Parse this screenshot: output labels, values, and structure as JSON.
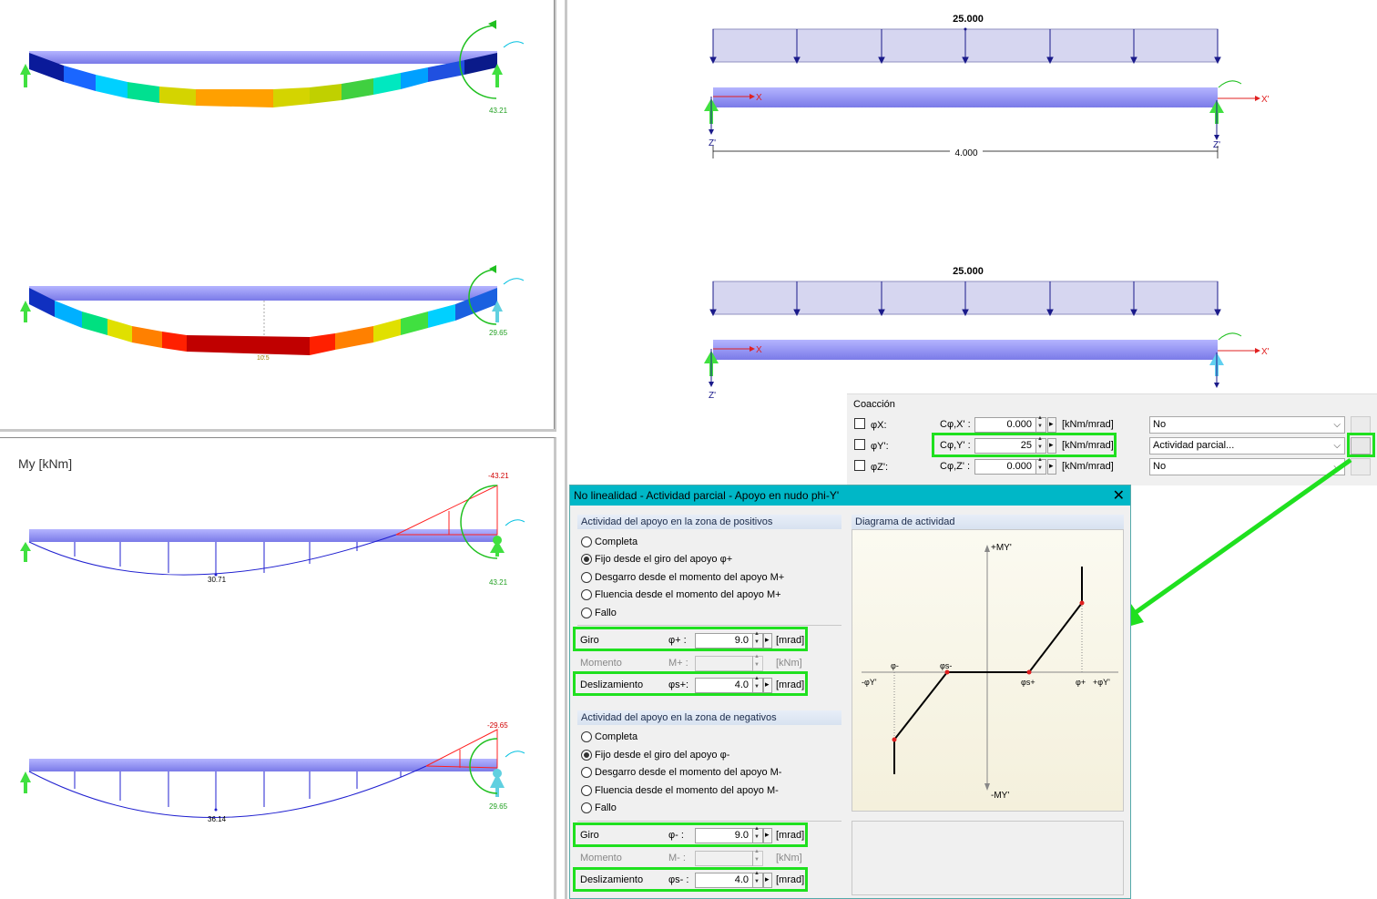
{
  "top_left": {
    "beam1": {
      "value_right": "43.21"
    },
    "beam2": {
      "value_right": "29.65",
      "value_mid": "10.5"
    }
  },
  "moment_panel": {
    "title": "My [kNm]",
    "beam1": {
      "top_value": "-43.21",
      "mid_value": "30.71",
      "support_value": "43.21"
    },
    "beam2": {
      "top_value": "-29.65",
      "mid_value": "36.14",
      "support_value": "29.65"
    }
  },
  "right_panel": {
    "load_value_1": "25.000",
    "load_value_2": "25.000",
    "axis_x": "X",
    "axis_x2": "X'",
    "axis_z": "Z'",
    "span": "4.000"
  },
  "coaccion": {
    "title": "Coacción",
    "rows": [
      {
        "phi": "φX:",
        "c": "Cφ,X' :",
        "value": "0.000",
        "unit": "[kNm/mrad]",
        "select": "No"
      },
      {
        "phi": "φY':",
        "c": "Cφ,Y' :",
        "value": "25",
        "unit": "[kNm/mrad]",
        "select": "Actividad parcial..."
      },
      {
        "phi": "φZ':",
        "c": "Cφ,Z' :",
        "value": "0.000",
        "unit": "[kNm/mrad]",
        "select": "No"
      }
    ]
  },
  "dialog": {
    "title": "No linealidad - Actividad parcial - Apoyo en nudo phi-Y'",
    "pos_group": {
      "header": "Actividad del apoyo en la zona de positivos",
      "options": [
        "Completa",
        "Fijo desde el giro del apoyo φ+",
        "Desgarro desde el momento del apoyo M+",
        "Fluencia desde el momento del apoyo M+",
        "Fallo"
      ],
      "giro_label": "Giro",
      "giro_sym": "φ+  :",
      "giro_value": "9.0",
      "giro_unit": "[mrad]",
      "momento_label": "Momento",
      "momento_sym": "M+ :",
      "momento_unit": "[kNm]",
      "desl_label": "Deslizamiento",
      "desl_sym": "φs+:",
      "desl_value": "4.0",
      "desl_unit": "[mrad]"
    },
    "neg_group": {
      "header": "Actividad del apoyo en la zona de negativos",
      "options": [
        "Completa",
        "Fijo desde el giro del apoyo φ-",
        "Desgarro desde el momento del apoyo M-",
        "Fluencia desde el momento del apoyo M-",
        "Fallo"
      ],
      "giro_label": "Giro",
      "giro_sym": "φ-  :",
      "giro_value": "9.0",
      "giro_unit": "[mrad]",
      "momento_label": "Momento",
      "momento_sym": "M- :",
      "momento_unit": "[kNm]",
      "desl_label": "Deslizamiento",
      "desl_sym": "φs- :",
      "desl_value": "4.0",
      "desl_unit": "[mrad]"
    },
    "diagram": {
      "header": "Diagrama de actividad",
      "plus_m": "+MY'",
      "minus_m": "-MY'",
      "minus_phi": "-φY'",
      "plus_phi": "+φY'",
      "phi_minus": "φ-",
      "phi_s_minus": "φs-",
      "phi_s_plus": "φs+",
      "phi_plus": "φ+"
    }
  },
  "colors": {
    "highlight": "#1fe01f",
    "beam": "#8c8cf0",
    "dialog_title": "#00b7c7"
  }
}
